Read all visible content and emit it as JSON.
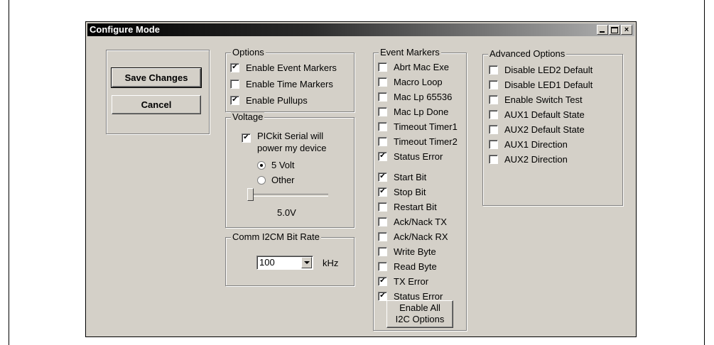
{
  "window": {
    "title": "Configure Mode",
    "controls": {
      "close": "×"
    }
  },
  "actions": {
    "save_label": "Save Changes",
    "cancel_label": "Cancel"
  },
  "options": {
    "title": "Options",
    "items": [
      {
        "label": "Enable Event Markers",
        "checked": true
      },
      {
        "label": "Enable Time Markers",
        "checked": false
      },
      {
        "label": "Enable Pullups",
        "checked": true
      }
    ]
  },
  "voltage": {
    "title": "Voltage",
    "power": {
      "line1": "PICkit Serial will",
      "line2": "power my device",
      "checked": true
    },
    "radios": [
      {
        "label": "5 Volt",
        "selected": true
      },
      {
        "label": "Other",
        "selected": false
      }
    ],
    "level": 0,
    "value_text": "5.0V"
  },
  "bitrate": {
    "title": "Comm I2CM Bit Rate",
    "value": "100",
    "unit": "kHz"
  },
  "event_markers": {
    "title": "Event Markers",
    "items": [
      {
        "label": "Abrt Mac Exe",
        "checked": false
      },
      {
        "label": "Macro Loop",
        "checked": false
      },
      {
        "label": "Mac Lp 65536",
        "checked": false
      },
      {
        "label": "Mac Lp Done",
        "checked": false
      },
      {
        "label": "Timeout Timer1",
        "checked": false
      },
      {
        "label": "Timeout Timer2",
        "checked": false
      },
      {
        "label": "Status Error",
        "checked": true
      },
      {
        "label": "Start Bit",
        "checked": true
      },
      {
        "label": "Stop Bit",
        "checked": true
      },
      {
        "label": "Restart Bit",
        "checked": false
      },
      {
        "label": "Ack/Nack TX",
        "checked": false
      },
      {
        "label": "Ack/Nack RX",
        "checked": false
      },
      {
        "label": "Write Byte",
        "checked": false
      },
      {
        "label": "Read Byte",
        "checked": false
      },
      {
        "label": "TX Error",
        "checked": true
      },
      {
        "label": "Status Error",
        "checked": true
      }
    ],
    "enable_all": {
      "line1": "Enable All",
      "line2": "I2C Options"
    }
  },
  "advanced": {
    "title": "Advanced Options",
    "items": [
      {
        "label": "Disable LED2 Default",
        "checked": false
      },
      {
        "label": "Disable LED1 Default",
        "checked": false
      },
      {
        "label": "Enable Switch Test",
        "checked": false
      },
      {
        "label": "AUX1 Default State",
        "checked": false
      },
      {
        "label": "AUX2 Default State",
        "checked": false
      },
      {
        "label": "AUX1 Direction",
        "checked": false
      },
      {
        "label": "AUX2 Direction",
        "checked": false
      }
    ]
  }
}
